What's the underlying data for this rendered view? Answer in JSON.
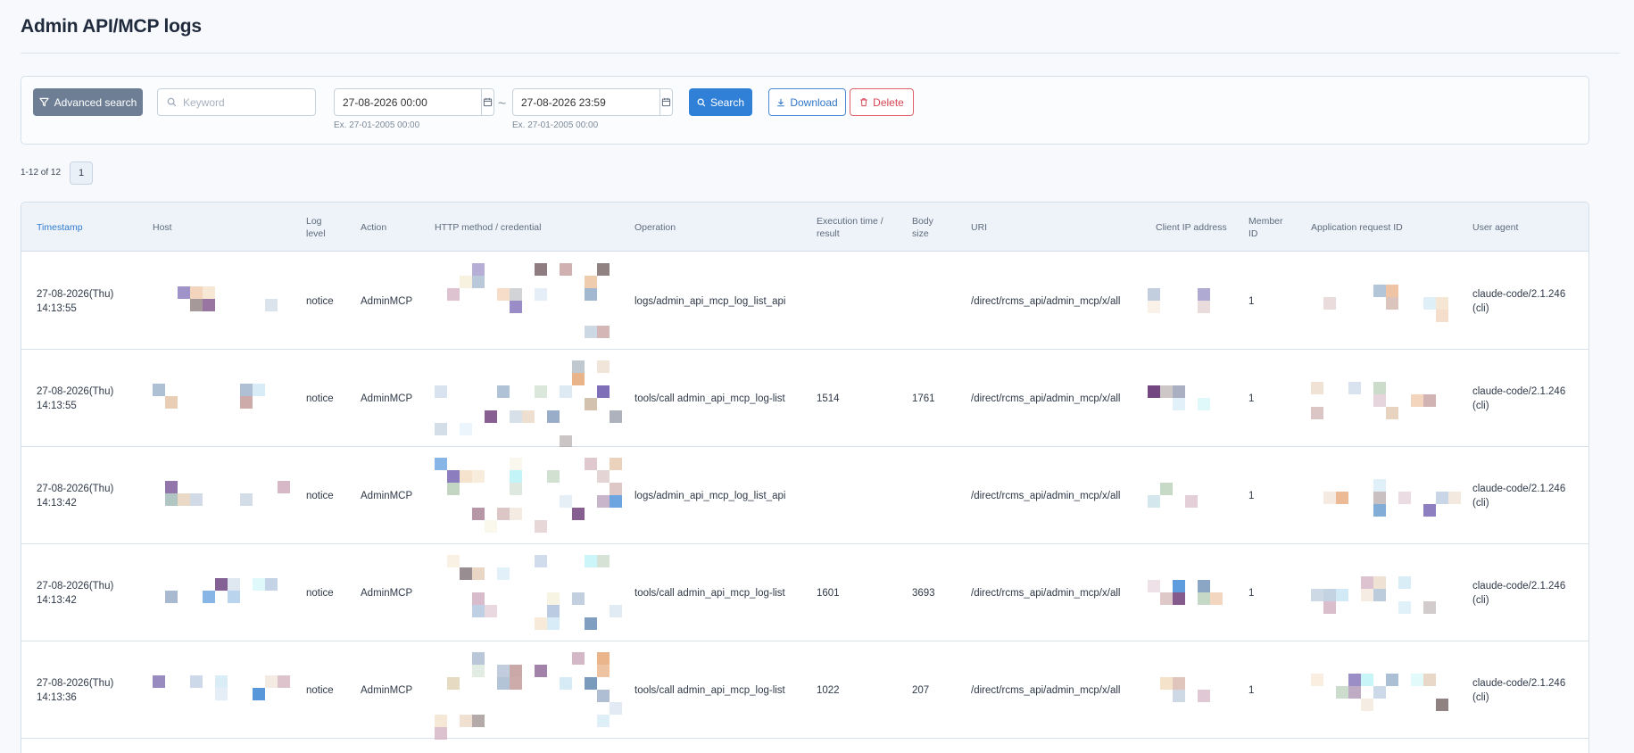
{
  "page": {
    "title": "Admin API/MCP logs"
  },
  "search": {
    "advanced_label": "Advanced search",
    "keyword_placeholder": "Keyword",
    "date_from": "27-08-2026 00:00",
    "date_to": "27-08-2026 23:59",
    "date_from_hint": "Ex. 27-01-2005 00:00",
    "date_to_hint": "Ex. 27-01-2005 00:00",
    "range_separator": "~",
    "search_label": "Search",
    "download_label": "Download",
    "delete_label": "Delete"
  },
  "pagination": {
    "info": "1-12 of 12",
    "current_page": "1"
  },
  "table": {
    "columns": {
      "timestamp": "Timestamp",
      "host": "Host",
      "log_level": "Log level",
      "action": "Action",
      "method": "HTTP method / credential",
      "operation": "Operation",
      "exec": "Execution time / result",
      "body": "Body size",
      "uri": "URI",
      "ip": "Client IP address",
      "member": "Member ID",
      "app_req": "Application request ID",
      "ua": "User agent"
    },
    "rows": [
      {
        "date": "27-08-2026(Thu)",
        "time": "14:13:55",
        "level": "notice",
        "action": "AdminMCP",
        "operation": "logs/admin_api_mcp_log_list_api",
        "exec": "",
        "body": "",
        "uri": "/direct/rcms_api/admin_mcp/x/all",
        "member": "1",
        "ua": "claude-code/2.1.246",
        "ua2": "(cli)"
      },
      {
        "date": "27-08-2026(Thu)",
        "time": "14:13:55",
        "level": "notice",
        "action": "AdminMCP",
        "operation": "tools/call admin_api_mcp_log-list",
        "exec": "1514",
        "body": "1761",
        "uri": "/direct/rcms_api/admin_mcp/x/all",
        "member": "1",
        "ua": "claude-code/2.1.246",
        "ua2": "(cli)"
      },
      {
        "date": "27-08-2026(Thu)",
        "time": "14:13:42",
        "level": "notice",
        "action": "AdminMCP",
        "operation": "logs/admin_api_mcp_log_list_api",
        "exec": "",
        "body": "",
        "uri": "/direct/rcms_api/admin_mcp/x/all",
        "member": "1",
        "ua": "claude-code/2.1.246",
        "ua2": "(cli)"
      },
      {
        "date": "27-08-2026(Thu)",
        "time": "14:13:42",
        "level": "notice",
        "action": "AdminMCP",
        "operation": "tools/call admin_api_mcp_log-list",
        "exec": "1601",
        "body": "3693",
        "uri": "/direct/rcms_api/admin_mcp/x/all",
        "member": "1",
        "ua": "claude-code/2.1.246",
        "ua2": "(cli)"
      },
      {
        "date": "27-08-2026(Thu)",
        "time": "14:13:36",
        "level": "notice",
        "action": "AdminMCP",
        "operation": "tools/call admin_api_mcp_log-list",
        "exec": "1022",
        "body": "207",
        "uri": "/direct/rcms_api/admin_mcp/x/all",
        "member": "1",
        "ua": "claude-code/2.1.246",
        "ua2": "(cli)"
      }
    ]
  },
  "colors": {
    "primary": "#2f80d6",
    "advanced_bg": "#6e7f95",
    "delete": "#d84654",
    "sorted_header": "#2f7bd0"
  },
  "icons": {
    "advanced": "filter-icon",
    "keyword": "search-icon",
    "date": "calendar-icon",
    "search": "search-icon",
    "download": "download-icon",
    "delete": "trash-icon"
  }
}
